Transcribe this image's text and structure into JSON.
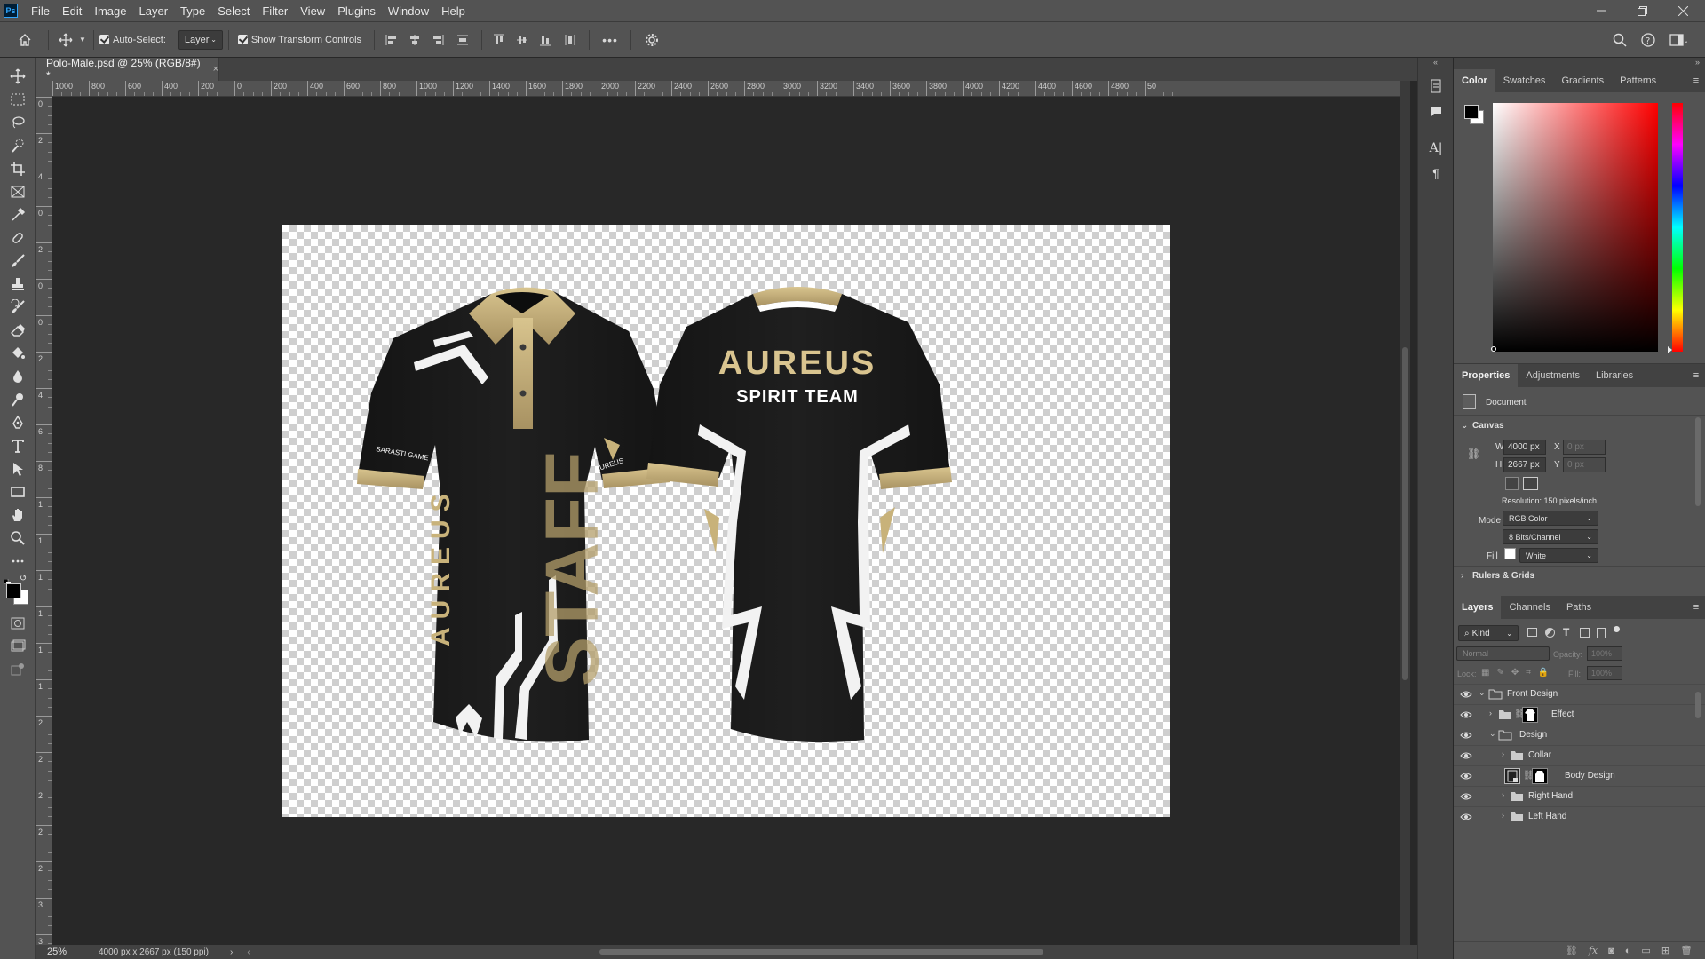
{
  "app": {
    "logo": "Ps"
  },
  "menu": [
    "File",
    "Edit",
    "Image",
    "Layer",
    "Type",
    "Select",
    "Filter",
    "View",
    "Plugins",
    "Window",
    "Help"
  ],
  "options": {
    "auto_select_label": "Auto-Select:",
    "auto_select_value": "Layer",
    "show_transform_label": "Show Transform Controls",
    "more": "•••"
  },
  "document": {
    "tab_title": "Polo-Male.psd @ 25% (RGB/8#) *",
    "close": "×",
    "zoom": "25%",
    "size_info": "4000 px x 2667 px (150 ppi)"
  },
  "ruler": {
    "h_ticks": [
      "1000",
      "800",
      "600",
      "400",
      "200",
      "0",
      "200",
      "400",
      "600",
      "800",
      "1000",
      "1200",
      "1400",
      "1600",
      "1800",
      "2000",
      "2200",
      "2400",
      "2600",
      "2800",
      "3000",
      "3200",
      "3400",
      "3600",
      "3800",
      "4000",
      "4200",
      "4400",
      "4600",
      "4800",
      "50"
    ],
    "v_ticks": [
      "0",
      "2",
      "4",
      "0",
      "2",
      "0",
      "0",
      "2",
      "4",
      "6",
      "8",
      "1",
      "1",
      "1",
      "1",
      "1",
      "1",
      "2",
      "2",
      "2",
      "2",
      "2",
      "3",
      "3",
      "3"
    ]
  },
  "artwork": {
    "front_vertical_text": "AUREUS",
    "front_big_text": "STAFF",
    "front_patch_text": "SARASTI GAME",
    "front_sleeve_text": "AUREUS",
    "back_title": "AUREUS",
    "back_subtitle": "SPIRIT TEAM"
  },
  "color_panel": {
    "tabs": [
      "Color",
      "Swatches",
      "Gradients",
      "Patterns"
    ],
    "active": "Color"
  },
  "properties_panel": {
    "tabs": [
      "Properties",
      "Adjustments",
      "Libraries"
    ],
    "doc_label": "Document",
    "canvas_section": "Canvas",
    "w_label": "W",
    "w_value": "4000 px",
    "h_label": "H",
    "h_value": "2667 px",
    "x_label": "X",
    "x_value": "0 px",
    "y_label": "Y",
    "y_value": "0 px",
    "resolution": "Resolution: 150 pixels/inch",
    "mode_label": "Mode",
    "mode_value": "RGB Color",
    "bits_value": "8 Bits/Channel",
    "fill_label": "Fill",
    "fill_value": "White",
    "rulers_section": "Rulers & Grids"
  },
  "layers_panel": {
    "tabs": [
      "Layers",
      "Channels",
      "Paths"
    ],
    "kind_label": "Kind",
    "blend_mode": "Normal",
    "opacity_label": "Opacity:",
    "opacity_value": "100%",
    "lock_label": "Lock:",
    "fill_label": "Fill:",
    "fill_value": "100%",
    "layers": [
      {
        "name": "Front Design",
        "type": "group",
        "open": true
      },
      {
        "name": "Effect",
        "type": "group-mask",
        "open": false
      },
      {
        "name": "Design",
        "type": "group",
        "open": true
      },
      {
        "name": "Collar",
        "type": "group",
        "open": false
      },
      {
        "name": "Body Design",
        "type": "smart-mask"
      },
      {
        "name": "Right Hand",
        "type": "group",
        "open": false
      },
      {
        "name": "Left Hand",
        "type": "group",
        "open": false
      }
    ]
  },
  "colors": {
    "ui_bg": "#535353",
    "canvas_bg": "#282828",
    "shirt_black": "#1f1f1f",
    "gold": "#c8b27a",
    "accent_blue": "#31a8ff"
  }
}
